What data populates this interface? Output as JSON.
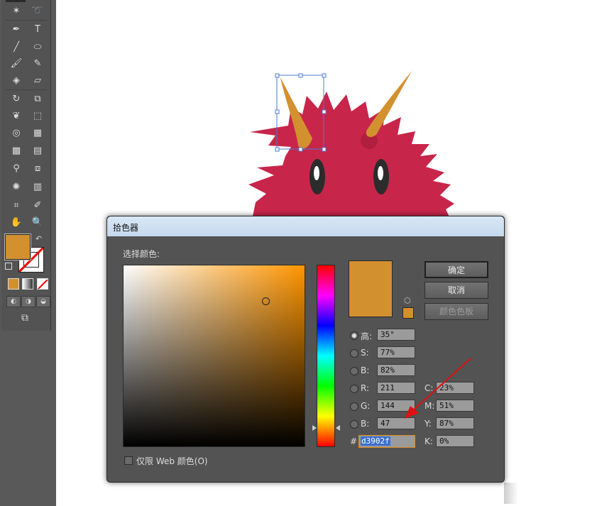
{
  "dialog": {
    "title": "拾色器",
    "select_color_label": "选择颜色:",
    "ok_label": "确定",
    "cancel_label": "取消",
    "swatches_label": "颜色色板",
    "web_colors_label": "仅限 Web 颜色(O)",
    "hsb": {
      "h_label": "高:",
      "h_value": "35°",
      "s_label": "S:",
      "s_value": "77%",
      "b_label": "B:",
      "b_value": "82%"
    },
    "rgb": {
      "r_label": "R:",
      "r_value": "211",
      "g_label": "G:",
      "g_value": "144",
      "b_label": "B:",
      "b_value": "47"
    },
    "cmyk": {
      "c_label": "C:",
      "c_value": "23%",
      "m_label": "M:",
      "m_value": "51%",
      "y_label": "Y:",
      "y_value": "87%",
      "k_label": "K:",
      "k_value": "0%"
    },
    "hex_label": "#",
    "hex_value": "d3902f",
    "current_color": "#d3902f"
  },
  "toolbar": {
    "fill_color": "#d3902f"
  },
  "canvas": {
    "monster_color": "#c8254a",
    "horn_color": "#d3902f"
  }
}
